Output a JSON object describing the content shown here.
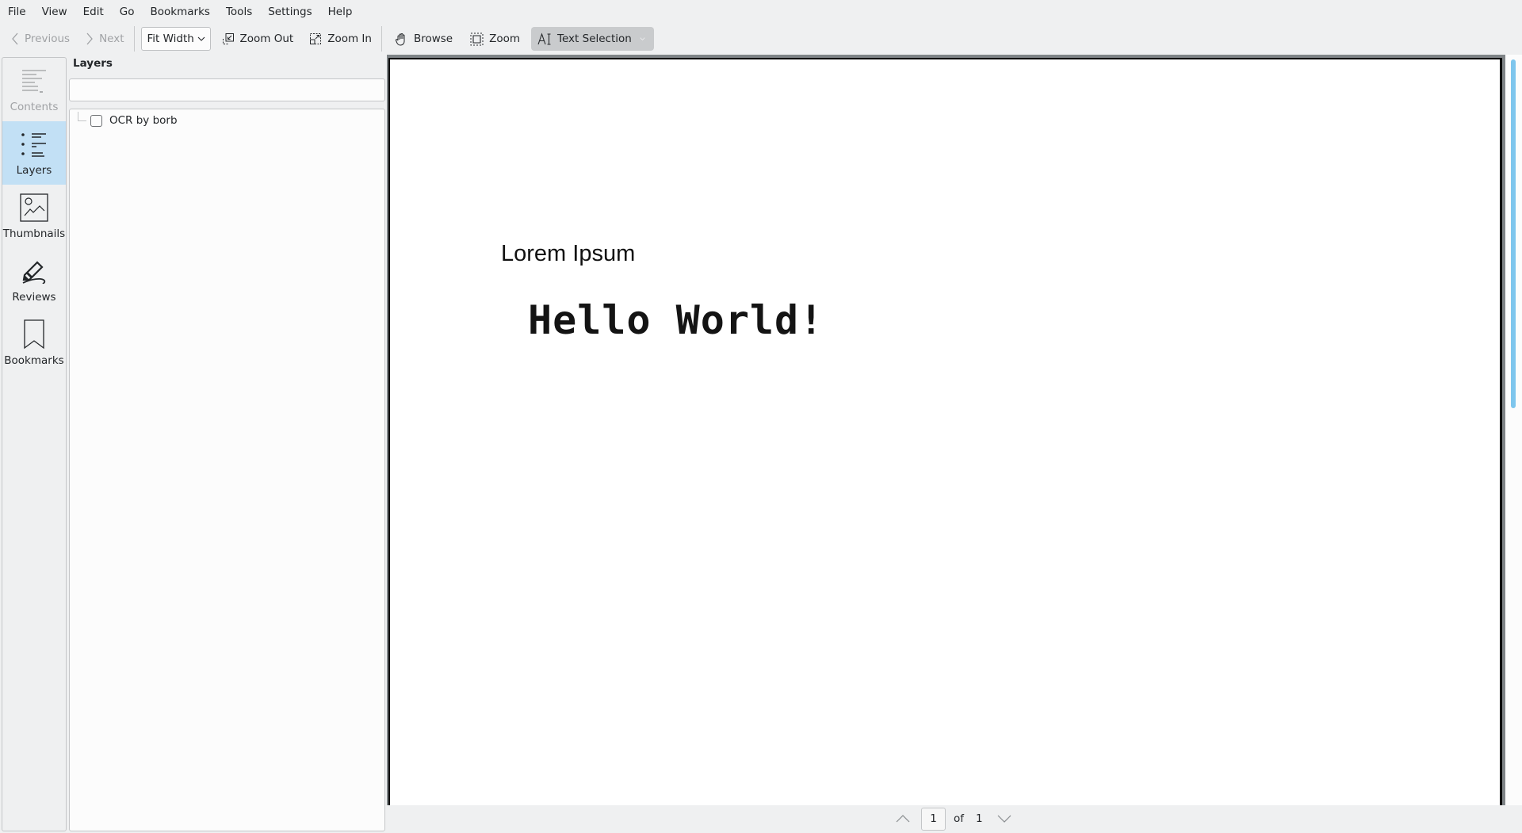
{
  "menubar": {
    "items": [
      "File",
      "View",
      "Edit",
      "Go",
      "Bookmarks",
      "Tools",
      "Settings",
      "Help"
    ]
  },
  "toolbar": {
    "previous": {
      "label": "Previous",
      "icon": "chevron-left-icon",
      "enabled": false
    },
    "next": {
      "label": "Next",
      "icon": "chevron-right-icon",
      "enabled": false
    },
    "zoom_mode": {
      "selected": "Fit Width"
    },
    "zoom_out": {
      "label": "Zoom Out",
      "icon": "zoom-out-icon"
    },
    "zoom_in": {
      "label": "Zoom In",
      "icon": "zoom-in-icon"
    },
    "browse": {
      "label": "Browse",
      "icon": "hand-icon"
    },
    "zoom_tool": {
      "label": "Zoom",
      "icon": "zoom-select-icon"
    },
    "text_selection": {
      "label": "Text Selection",
      "icon": "text-select-icon",
      "active": true
    }
  },
  "sidebar": {
    "items": [
      {
        "label": "Contents",
        "icon": "contents-icon",
        "enabled": false,
        "active": false
      },
      {
        "label": "Layers",
        "icon": "layers-icon",
        "enabled": true,
        "active": true
      },
      {
        "label": "Thumbnails",
        "icon": "image-icon",
        "enabled": true,
        "active": false
      },
      {
        "label": "Reviews",
        "icon": "pen-icon",
        "enabled": true,
        "active": false
      },
      {
        "label": "Bookmarks",
        "icon": "bookmark-icon",
        "enabled": true,
        "active": false
      }
    ]
  },
  "layers_panel": {
    "title": "Layers",
    "search": {
      "value": "",
      "placeholder": ""
    },
    "layers": [
      {
        "label": "OCR by borb",
        "checked": false
      }
    ]
  },
  "document": {
    "heading": "Lorem Ipsum",
    "body_text": "Hello World!"
  },
  "pagebar": {
    "current_page": "1",
    "of_label": "of",
    "total_pages": "1"
  },
  "colors": {
    "accent": "#3daee9",
    "selected_background": "#c2e0f5",
    "scrollbar_thumb": "#7ec6ed",
    "window_background": "#eff0f1"
  }
}
